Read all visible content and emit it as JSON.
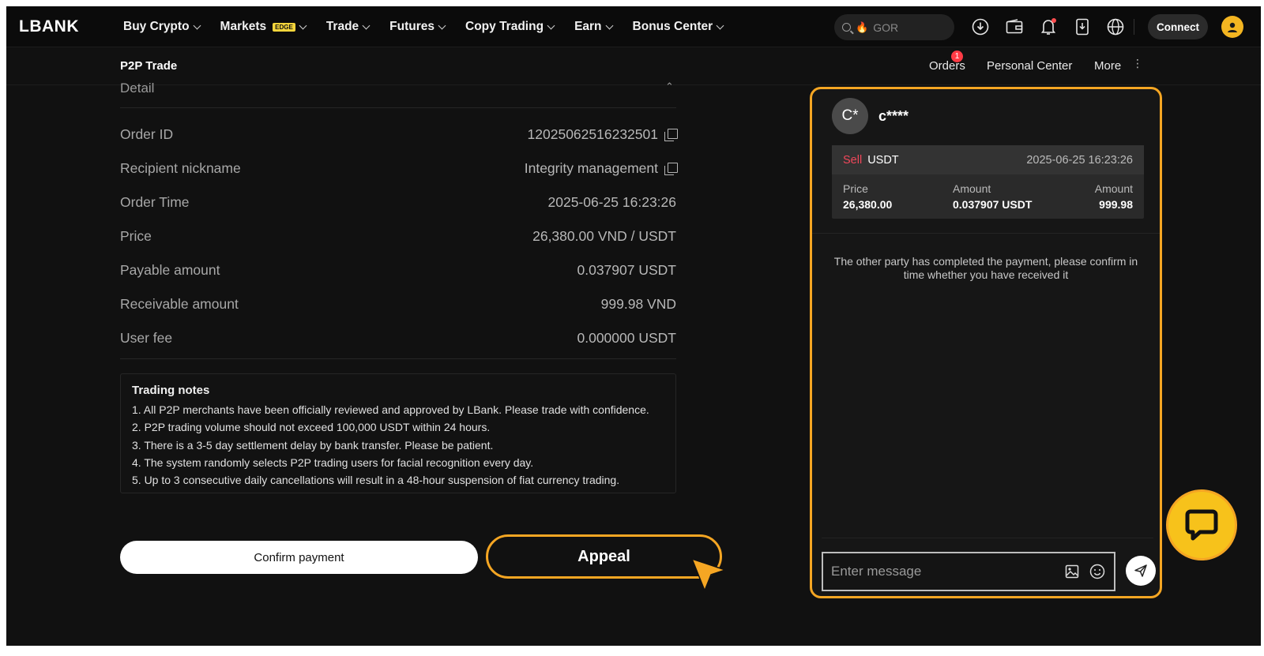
{
  "header": {
    "logo": "LBANK",
    "nav": [
      {
        "label": "Buy Crypto"
      },
      {
        "label": "Markets",
        "badge": "EDGE"
      },
      {
        "label": "Trade"
      },
      {
        "label": "Futures"
      },
      {
        "label": "Copy Trading"
      },
      {
        "label": "Earn"
      },
      {
        "label": "Bonus Center"
      }
    ],
    "search_text": "GOR",
    "connect_label": "Connect"
  },
  "subheader": {
    "title": "P2P Trade",
    "orders_label": "Orders",
    "orders_badge": "1",
    "personal_center_label": "Personal Center",
    "more_label": "More"
  },
  "detail": {
    "heading": "Detail",
    "rows": [
      {
        "label": "Order ID",
        "value": "12025062516232501",
        "copy": true
      },
      {
        "label": "Recipient nickname",
        "value": "Integrity management",
        "copy": true
      },
      {
        "label": "Order Time",
        "value": "2025-06-25 16:23:26"
      },
      {
        "label": "Price",
        "value": "26,380.00 VND / USDT"
      },
      {
        "label": "Payable amount",
        "value": "0.037907 USDT"
      },
      {
        "label": "Receivable amount",
        "value": "999.98 VND"
      },
      {
        "label": "User fee",
        "value": "0.000000 USDT"
      }
    ]
  },
  "trading_notes": {
    "title": "Trading notes",
    "lines": [
      "1. All P2P merchants have been officially reviewed and approved by LBank. Please trade with confidence.",
      "2. P2P trading volume should not exceed 100,000 USDT within 24 hours.",
      "3. There is a 3-5 day settlement delay by bank transfer. Please be patient.",
      "4. The system randomly selects P2P trading users for facial recognition every day.",
      "5. Up to 3 consecutive daily cancellations will result in a 48-hour suspension of fiat currency trading."
    ]
  },
  "actions": {
    "confirm_label": "Confirm payment",
    "appeal_label": "Appeal"
  },
  "chat": {
    "avatar_text": "C*",
    "name": "c****",
    "order": {
      "side": "Sell",
      "coin": "USDT",
      "time": "2025-06-25 16:23:26",
      "price_label": "Price",
      "price": "26,380.00",
      "amount_label": "Amount",
      "amount": "0.037907 USDT",
      "total_label": "Amount",
      "total": "999.98"
    },
    "system_message": "The other party has completed the payment, please confirm in time whether you have received it",
    "input_placeholder": "Enter message"
  },
  "colors": {
    "accent_orange": "#f5a623",
    "sell_red": "#f0475a",
    "support_yellow": "#f7c21b"
  }
}
